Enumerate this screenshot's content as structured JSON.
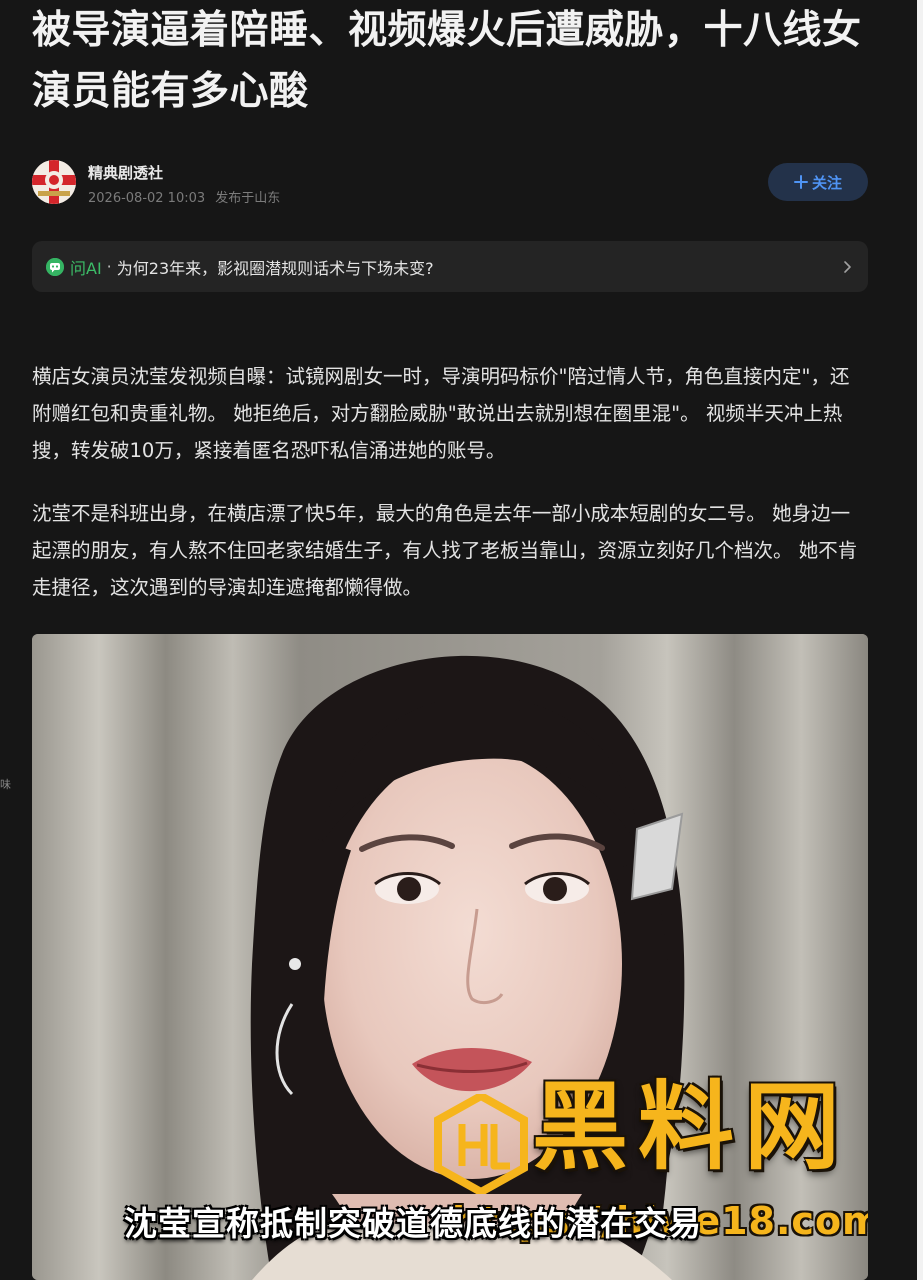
{
  "article": {
    "title": "被导演逼着陪睡、视频爆火后遭威胁，十八线女演员能有多心酸",
    "paragraphs": [
      "横店女演员沈莹发视频自曝：试镜网剧女一时，导演明码标价\"陪过情人节，角色直接内定\"，还附赠红包和贵重礼物。 她拒绝后，对方翻脸威胁\"敢说出去就别想在圈里混\"。 视频半天冲上热搜，转发破10万，紧接着匿名恐吓私信涌进她的账号。",
      "沈莹不是科班出身，在横店漂了快5年，最大的角色是去年一部小成本短剧的女二号。 她身边一起漂的朋友，有人熬不住回老家结婚生子，有人找了老板当靠山，资源立刻好几个档次。 她不肯走捷径，这次遇到的导演却连遮掩都懒得做。"
    ]
  },
  "author": {
    "name": "精典剧透社",
    "date": "2026-08-02 10:03",
    "location": "发布于山东",
    "follow_label": "关注",
    "follow_icon": "plus-icon"
  },
  "ai_bar": {
    "label": "问AI",
    "separator": "·",
    "question": "为何23年来，影视圈潜规则话术与下场未变?",
    "icon": "ai-chat-icon"
  },
  "image": {
    "caption": "沈莹宣称抵制突破道德底线的潜在交易",
    "watermark_brand": "黑料网",
    "watermark_url": "https://hlwe18.com"
  },
  "edge_text": "味",
  "colors": {
    "background": "#161616",
    "accent_blue": "#4f94f4",
    "follow_bg": "#23324a",
    "ai_green": "#3cbd68",
    "watermark_gold": "#f6b51c"
  }
}
